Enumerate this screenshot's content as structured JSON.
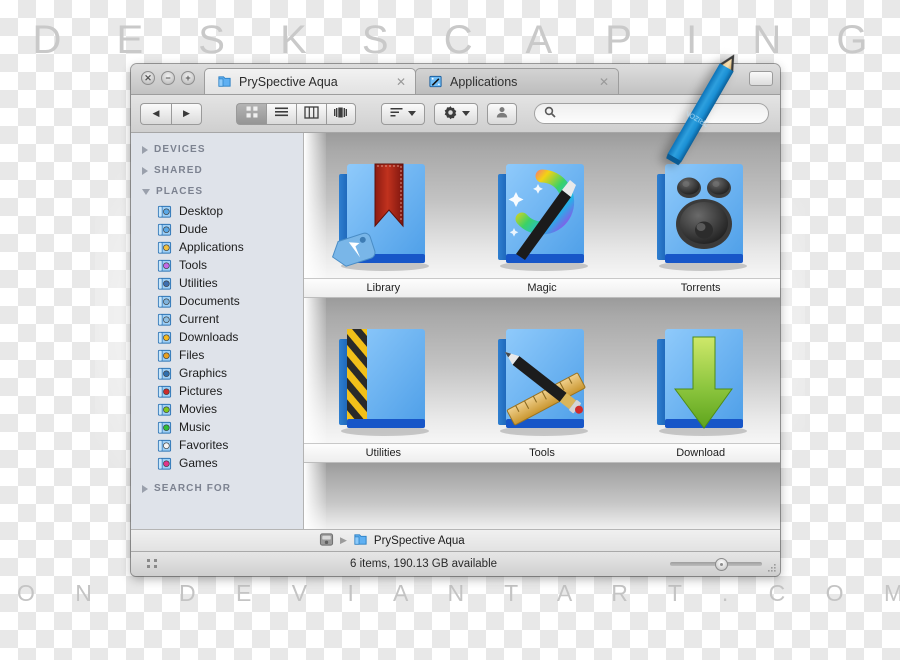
{
  "watermark": {
    "top": "D E S K S C A P I N G",
    "bottom": "O N   D E V I A N T A R T . C O M"
  },
  "window": {
    "traffic_lights": [
      {
        "name": "close",
        "glyph": "✕"
      },
      {
        "name": "minimize",
        "glyph": "−"
      },
      {
        "name": "zoom",
        "glyph": "+"
      }
    ],
    "tabs": [
      {
        "label": "PrySpective Aqua",
        "icon": "folder-icon",
        "active": true,
        "close_glyph": "✕"
      },
      {
        "label": "Applications",
        "icon": "applications-folder-icon",
        "active": false,
        "close_glyph": "✕"
      }
    ]
  },
  "toolbar": {
    "back_glyph": "◀",
    "forward_glyph": "▶",
    "views": [
      {
        "name": "icon-view",
        "selected": true
      },
      {
        "name": "list-view",
        "selected": false
      },
      {
        "name": "column-view",
        "selected": false
      },
      {
        "name": "coverflow-view",
        "selected": false
      }
    ],
    "arrange_label": "",
    "action_label": "",
    "share_label": "",
    "search": {
      "value": "",
      "placeholder": ""
    }
  },
  "sidebar": {
    "sections": [
      {
        "title": "DEVICES",
        "expanded": false,
        "items": []
      },
      {
        "title": "SHARED",
        "expanded": false,
        "items": []
      },
      {
        "title": "PLACES",
        "expanded": true,
        "items": [
          {
            "label": "Desktop",
            "icon": "folder-desktop-icon",
            "color": "#5aa8e6"
          },
          {
            "label": "Dude",
            "icon": "folder-dude-icon",
            "color": "#5aa8e6"
          },
          {
            "label": "Applications",
            "icon": "folder-applications-icon",
            "color": "#f0c040"
          },
          {
            "label": "Tools",
            "icon": "folder-tools-icon",
            "color": "#c46ae8"
          },
          {
            "label": "Utilities",
            "icon": "folder-utilities-icon",
            "color": "#3d6fb0"
          },
          {
            "label": "Documents",
            "icon": "folder-documents-icon",
            "color": "#7fb3dd"
          },
          {
            "label": "Current",
            "icon": "folder-current-icon",
            "color": "#8fc0e4"
          },
          {
            "label": "Downloads",
            "icon": "folder-downloads-icon",
            "color": "#f4b91f"
          },
          {
            "label": "Files",
            "icon": "folder-files-icon",
            "color": "#e8a020"
          },
          {
            "label": "Graphics",
            "icon": "folder-graphics-icon",
            "color": "#2f6fae"
          },
          {
            "label": "Pictures",
            "icon": "folder-pictures-icon",
            "color": "#cc2b2b"
          },
          {
            "label": "Movies",
            "icon": "folder-movies-icon",
            "color": "#7ec81e"
          },
          {
            "label": "Music",
            "icon": "folder-music-icon",
            "color": "#2fbd3a"
          },
          {
            "label": "Favorites",
            "icon": "folder-favorites-icon",
            "color": "#f4f4f4"
          },
          {
            "label": "Games",
            "icon": "folder-games-icon",
            "color": "#e0348a"
          }
        ]
      },
      {
        "title": "SEARCH FOR",
        "expanded": false,
        "items": []
      }
    ]
  },
  "content": {
    "rows": [
      [
        {
          "label": "Library",
          "icon": "folder-library-bookmark-icon"
        },
        {
          "label": "Magic",
          "icon": "folder-magic-wand-icon"
        },
        {
          "label": "Torrents",
          "icon": "folder-torrents-speaker-icon"
        }
      ],
      [
        {
          "label": "Utilities",
          "icon": "folder-utilities-hazard-icon"
        },
        {
          "label": "Tools",
          "icon": "folder-tools-pencil-ruler-icon"
        },
        {
          "label": "Download",
          "icon": "folder-download-arrow-icon"
        }
      ]
    ]
  },
  "pathbar": {
    "drive_icon": "hard-drive-icon",
    "separator": "▶",
    "items": [
      {
        "label": "PrySpective Aqua",
        "icon": "folder-icon"
      }
    ]
  },
  "statusbar": {
    "text": "6 items, 190.13 GB available",
    "zoom_percent": 50
  },
  "colors": {
    "folder_blue": "#4a9bea",
    "folder_blue_light": "#7fc1f5",
    "accent_green": "#8cc63f",
    "sidebar_bg": "#dfe3ea",
    "pencil_blue": "#1a8fd4"
  }
}
